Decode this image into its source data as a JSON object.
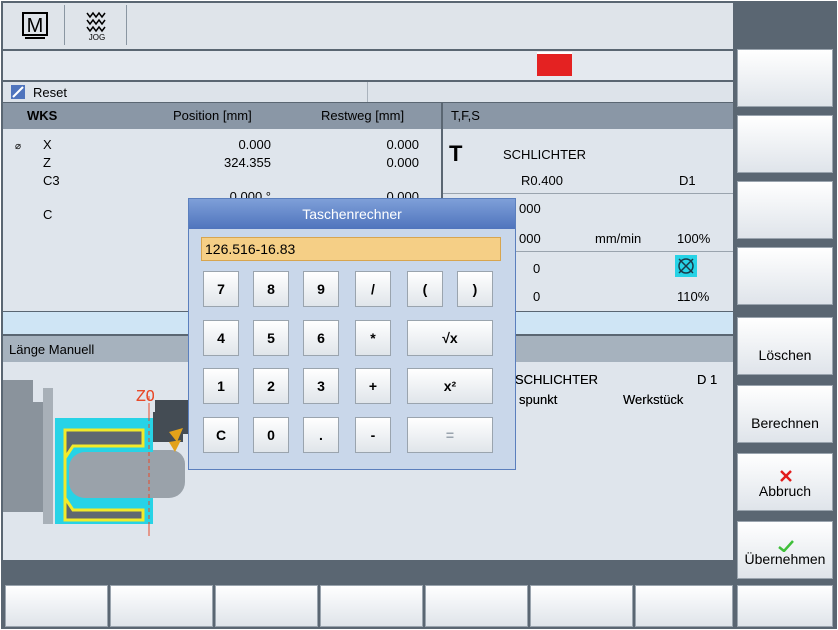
{
  "mode": {
    "icon": "machine-m-icon",
    "jog_label": "JOG"
  },
  "reset_label": "Reset",
  "positions": {
    "header": {
      "wks": "WKS",
      "position": "Position [mm]",
      "restweg": "Restweg [mm]"
    },
    "axes": [
      {
        "marker": "⌀",
        "name": "X",
        "position": "0.000",
        "restweg": "0.000"
      },
      {
        "marker": "",
        "name": "Z",
        "position": "324.355",
        "restweg": "0.000"
      },
      {
        "marker": "",
        "name": "C3",
        "position": "0.000 °",
        "restweg": "0.000"
      },
      {
        "marker": "",
        "name": "C",
        "position": "",
        "restweg": ""
      }
    ]
  },
  "tfs": {
    "header": "T,F,S",
    "tool_letter": "T",
    "tool_name": "SCHLICHTER",
    "radius": "R0.400",
    "dnum": "D1",
    "feed_value_1": "000",
    "feed_value_2": "000",
    "feed_unit": "mm/min",
    "feed_override": "100%",
    "spindle_value_1": "0",
    "spindle_value_2": "0",
    "spindle_override": "110%"
  },
  "laenge": {
    "title": "Länge Manuell",
    "tool_name": "SCHLICHTER",
    "dnum": "D 1",
    "ref_label": "spunkt",
    "ref_value": "Werkstück",
    "z_label": "Z0"
  },
  "calculator": {
    "title": "Taschenrechner",
    "input_value": "126.516-16.83",
    "keys": [
      [
        "7",
        "8",
        "9",
        "/",
        "(",
        ")"
      ],
      [
        "4",
        "5",
        "6",
        "*",
        "√x"
      ],
      [
        "1",
        "2",
        "3",
        "+",
        "x²"
      ],
      [
        "C",
        "0",
        ".",
        "-",
        "="
      ]
    ]
  },
  "softkeys": {
    "loeschen": "Löschen",
    "berechnen": "Berechnen",
    "abbruch": "Abbruch",
    "uebernehmen": "Übernehmen"
  },
  "colors": {
    "accent_blue": "#4f74bd",
    "input_bg": "#f5cf86",
    "alarm_red": "#e42222",
    "cancel_red": "#e21b1b",
    "ok_green": "#3fbf3a"
  }
}
